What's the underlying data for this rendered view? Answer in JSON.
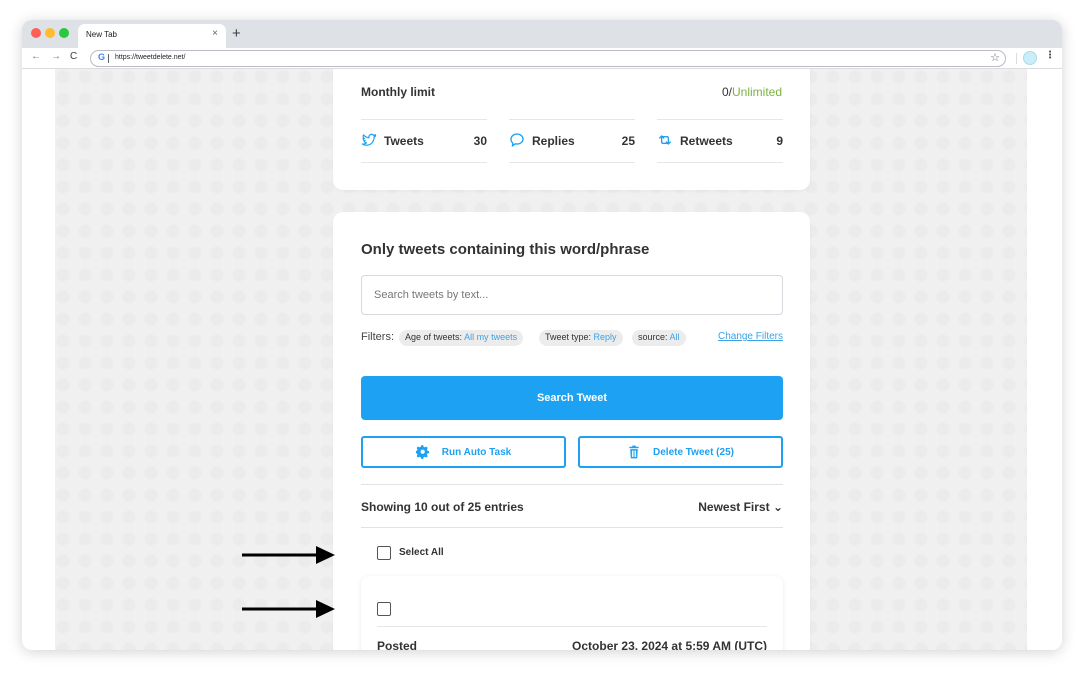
{
  "browser": {
    "tab_title": "New Tab",
    "tab_close": "×",
    "new_tab": "+",
    "url": "https://tweetdelete.net/",
    "nav_back": "←",
    "nav_forward": "→",
    "nav_reload": "C",
    "favicon": "G",
    "bookmark_icon": "☆",
    "menu_icon": "⋮"
  },
  "stats_card": {
    "limit_label": "Monthly limit",
    "limit_used": "0/",
    "limit_total": "Unlimited",
    "stats": [
      {
        "icon": "twitter-bird-icon",
        "label": "Tweets",
        "count": "30"
      },
      {
        "icon": "reply-bubble-icon",
        "label": "Replies",
        "count": "25"
      },
      {
        "icon": "retweet-icon",
        "label": "Retweets",
        "count": "9"
      }
    ]
  },
  "search_card": {
    "title": "Only tweets containing this word/phrase",
    "search_placeholder": "Search tweets by text...",
    "filters_label": "Filters:",
    "filter_chips": [
      {
        "key": "Age of tweets:",
        "value": "All my tweets"
      },
      {
        "key": "Tweet type:",
        "value": "Reply"
      },
      {
        "key": "source:",
        "value": "All"
      }
    ],
    "change_filters": "Change Filters",
    "search_button": "Search Tweet",
    "auto_task_button": "Run Auto Task",
    "delete_button": "Delete Tweet (25)",
    "entries_text": "Showing 10 out of 25 entries",
    "sort_label": "Newest First",
    "sort_chevron": "⌄",
    "select_all": "Select All",
    "tweet": {
      "posted_label": "Posted",
      "posted_date": "October 23, 2024 at 5:59 AM (UTC)"
    }
  },
  "colors": {
    "accent": "#1da1f2",
    "link": "#3aa3e8",
    "unlimited": "#7cb342"
  }
}
